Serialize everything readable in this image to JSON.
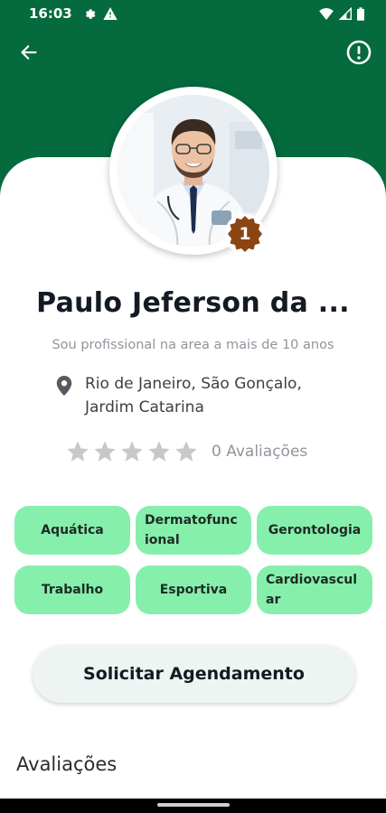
{
  "status_bar": {
    "time": "16:03"
  },
  "profile": {
    "name": "Paulo Jeferson da ...",
    "bio": "Sou profissional na area a mais de 10 anos",
    "location": [
      "Rio de Janeiro, São Gonçalo,",
      "Jardim Catarina"
    ],
    "rank": "1",
    "rating": {
      "stars_filled": 0,
      "stars_total": 5,
      "label": "0 Avaliações"
    }
  },
  "specialties": [
    "Aquática",
    "Dermatofuncional",
    "Gerontologia",
    "Trabalho",
    "Esportiva",
    "Cardiovascular"
  ],
  "specialty_display": [
    "Aquática",
    "Dermatofunc\nional",
    "Gerontologia",
    "Trabalho",
    "Esportiva",
    "Cardiovascul\nar"
  ],
  "cta": {
    "label": "Solicitar Agendamento"
  },
  "reviews_section": {
    "title": "Avaliações"
  },
  "colors": {
    "header": "#056a3e",
    "tag": "#86efac",
    "button": "#eef4f2",
    "star": "#c8c8c8",
    "badge": "#8b4513"
  },
  "icons": {
    "back": "arrow-left-icon",
    "report": "exclamation-circle-icon",
    "location": "map-pin-icon",
    "star": "star-icon"
  }
}
